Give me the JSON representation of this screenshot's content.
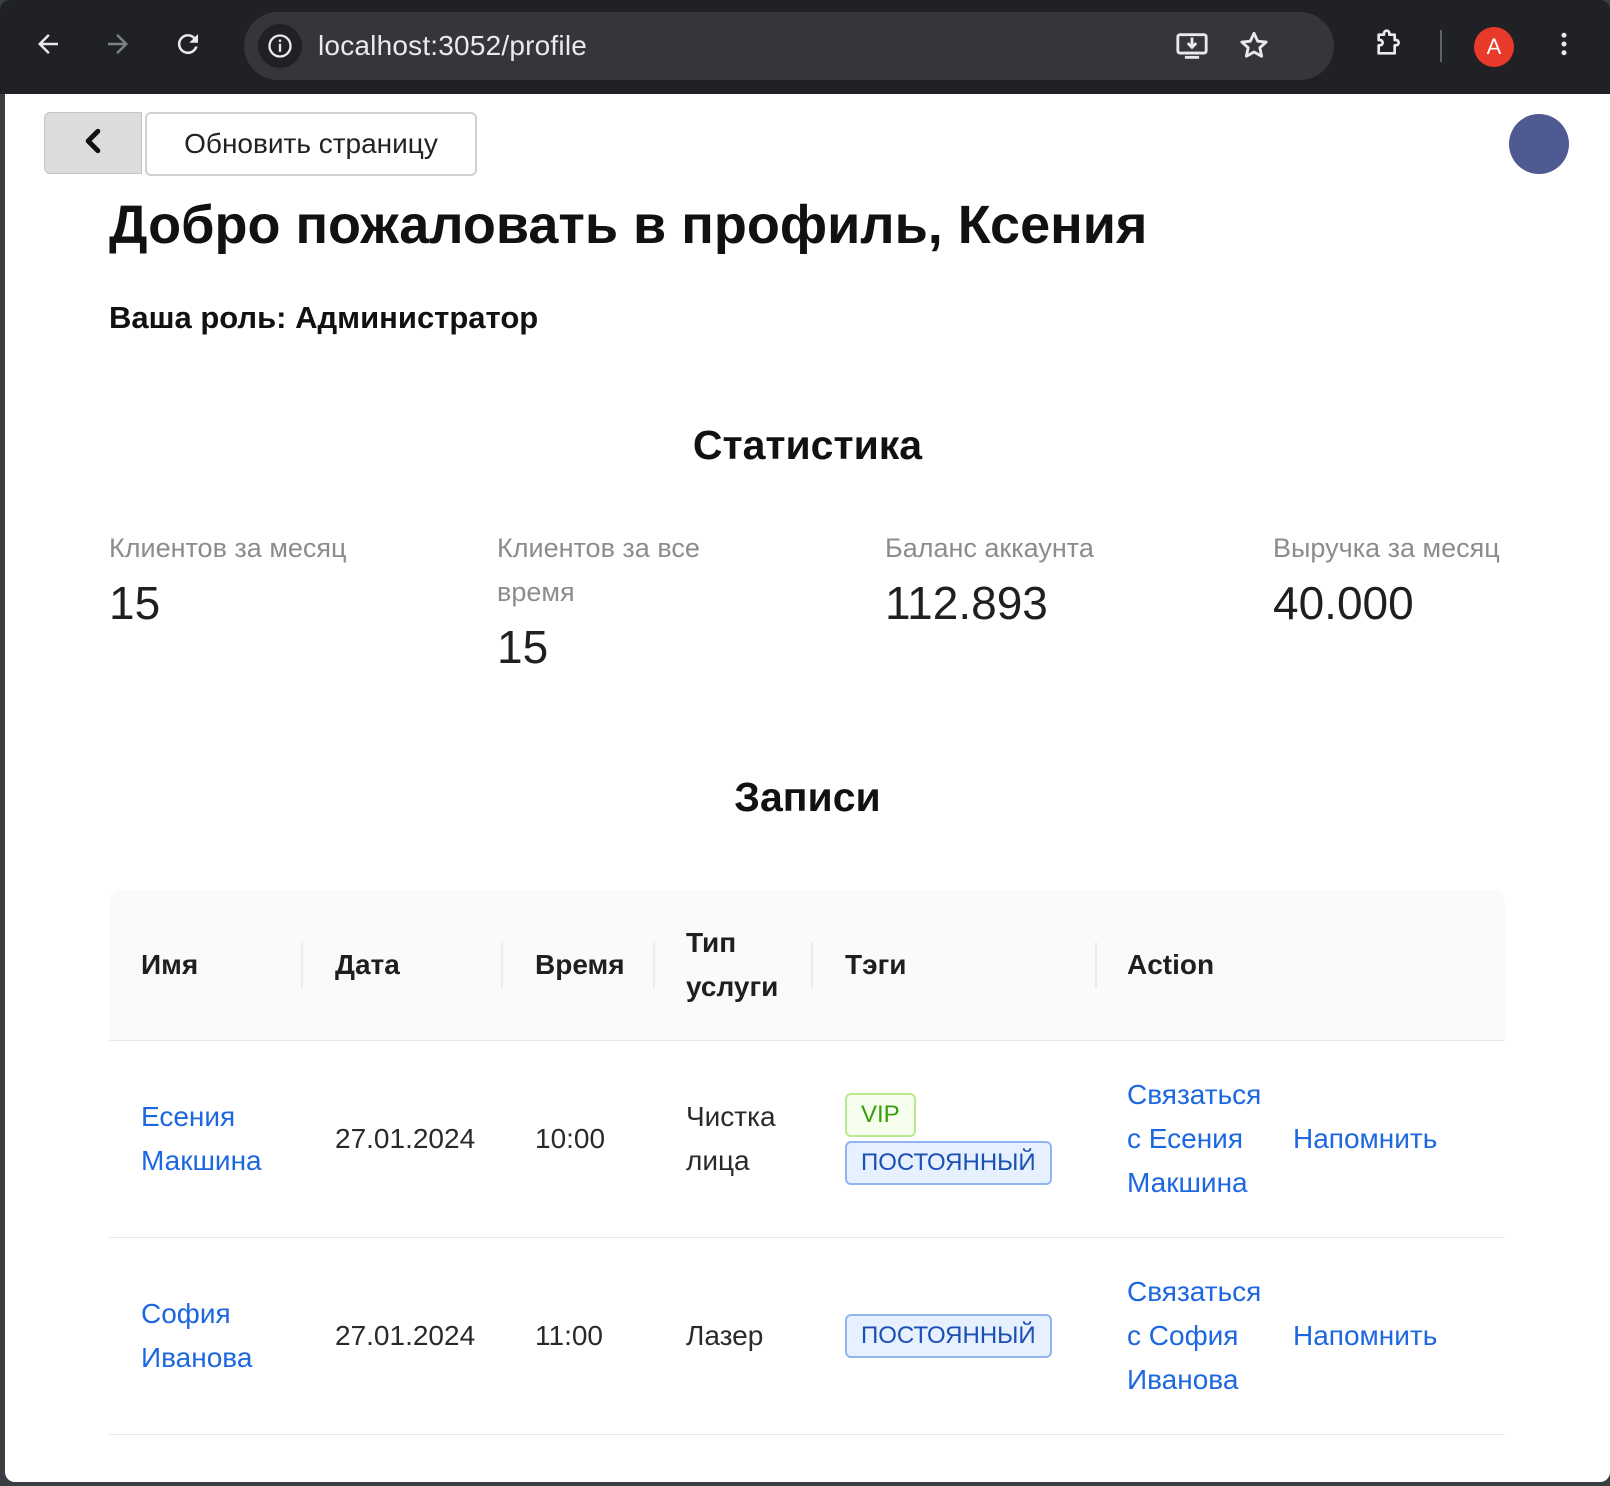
{
  "browser": {
    "url": "localhost:3052/profile",
    "profile_initial": "A"
  },
  "toolbar": {
    "refresh_label": "Обновить страницу"
  },
  "header": {
    "welcome": "Добро пожаловать в профиль, Ксения",
    "role": "Ваша роль: Администратор"
  },
  "stats": {
    "title": "Статистика",
    "items": [
      {
        "label": "Клиентов за месяц",
        "value": "15"
      },
      {
        "label": "Клиентов за все время",
        "value": "15"
      },
      {
        "label": "Баланс аккаунта",
        "value": "112.893"
      },
      {
        "label": "Выручка за месяц",
        "value": "40.000"
      }
    ]
  },
  "records": {
    "title": "Записи",
    "columns": [
      "Имя",
      "Дата",
      "Время",
      "Тип услуги",
      "Тэги",
      "Action"
    ],
    "rows": [
      {
        "name": "Есения Макшина",
        "date": "27.01.2024",
        "time": "10:00",
        "service": "Чистка лица",
        "tags": [
          "VIP",
          "ПОСТОЯННЫЙ"
        ],
        "contact": "Связаться с Есения Макшина",
        "remind": "Напомнить"
      },
      {
        "name": "София Иванова",
        "date": "27.01.2024",
        "time": "11:00",
        "service": "Лазер",
        "tags": [
          "ПОСТОЯННЫЙ"
        ],
        "contact": "Связаться с София Иванова",
        "remind": "Напомнить"
      }
    ]
  },
  "colors": {
    "link": "#1d68e0",
    "avatar": "#4f5a93",
    "chrome_bg": "#202124"
  }
}
